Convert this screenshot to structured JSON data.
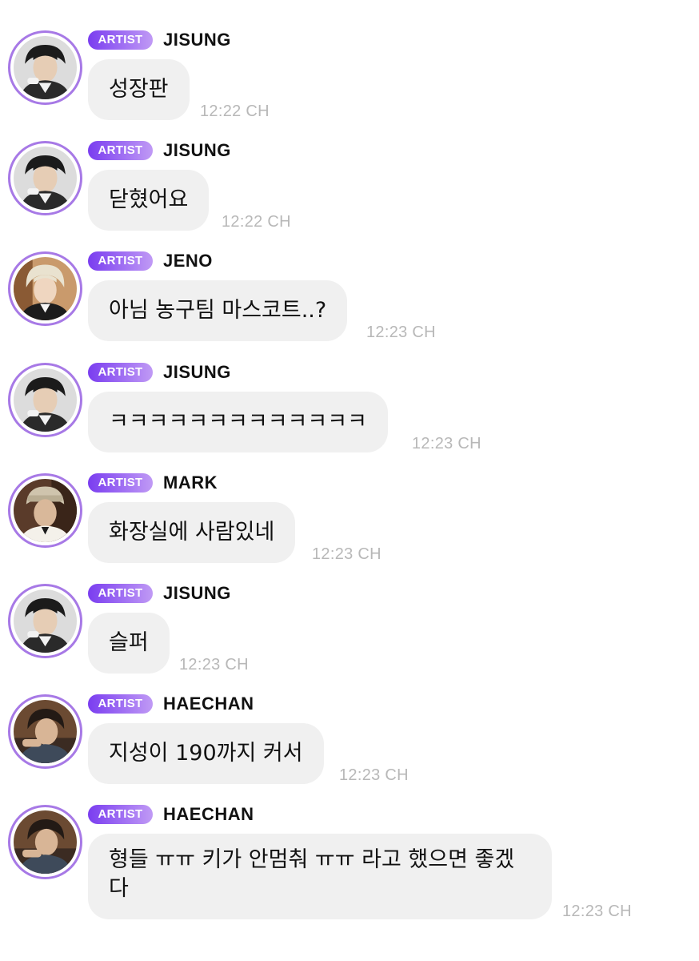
{
  "badge_label": "ARTIST",
  "colors": {
    "badge_start": "#7a3df0",
    "badge_end": "#c09af5",
    "avatar_ring": "#a779e6",
    "bubble_bg": "#f0f0f0",
    "timestamp": "#b8b8b8"
  },
  "messages": [
    {
      "sender": "JISUNG",
      "text": "성장판",
      "time": "12:22 CH",
      "avatar": "jisung-avatar"
    },
    {
      "sender": "JISUNG",
      "text": "닫혔어요",
      "time": "12:22 CH",
      "avatar": "jisung-avatar"
    },
    {
      "sender": "JENO",
      "text": "아님 농구팀 마스코트..?",
      "time": "12:23 CH",
      "avatar": "jeno-avatar"
    },
    {
      "sender": "JISUNG",
      "text": "ㅋㅋㅋㅋㅋㅋㅋㅋㅋㅋㅋㅋㅋ",
      "time": "12:23 CH",
      "avatar": "jisung-avatar"
    },
    {
      "sender": "MARK",
      "text": "화장실에 사람있네",
      "time": "12:23 CH",
      "avatar": "mark-avatar"
    },
    {
      "sender": "JISUNG",
      "text": "슬퍼",
      "time": "12:23 CH",
      "avatar": "jisung-avatar"
    },
    {
      "sender": "HAECHAN",
      "text": "지성이 190까지 커서",
      "time": "12:23 CH",
      "avatar": "haechan-avatar"
    },
    {
      "sender": "HAECHAN",
      "text": "형들 ㅠㅠ 키가 안멈춰 ㅠㅠ 라고 했으면 좋겠다",
      "time": "12:23 CH",
      "avatar": "haechan-avatar"
    }
  ]
}
